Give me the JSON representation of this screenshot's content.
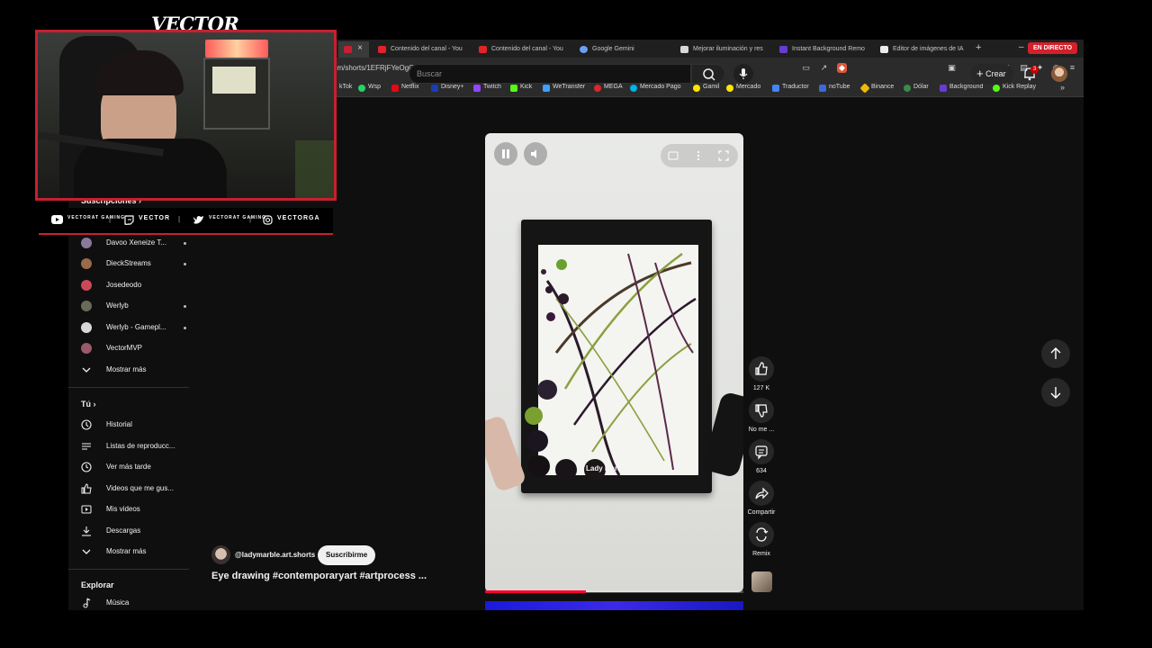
{
  "browser": {
    "tabs": [
      {
        "title": "",
        "fav_color": "#c7202f"
      },
      {
        "title": "Contenido del canal - You",
        "fav_color": "#e3222a"
      },
      {
        "title": "Contenido del canal - You",
        "fav_color": "#e3222a"
      },
      {
        "title": "Google Gemini",
        "fav_color": "#6aa0f4"
      },
      {
        "title": "Mejorar iluminación y res",
        "fav_color": "#d8d8d8"
      },
      {
        "title": "Instant Background Remo",
        "fav_color": "#6a3ad8"
      },
      {
        "title": "Editor de imágenes de IA",
        "fav_color": "#eaeaea"
      }
    ],
    "live_badge": "EN DIRECTO",
    "url": "om/shorts/1EFRjFYeOgQ",
    "bookmarks": [
      {
        "label": "kTok",
        "color": "#2b2b2b"
      },
      {
        "label": "Wsp",
        "color": "#25d366"
      },
      {
        "label": "Netflix",
        "color": "#e50914"
      },
      {
        "label": "Disney+",
        "color": "#1b3cb8"
      },
      {
        "label": "Twitch",
        "color": "#9146ff"
      },
      {
        "label": "Kick",
        "color": "#53fc18"
      },
      {
        "label": "WeTransfer",
        "color": "#409fff"
      },
      {
        "label": "MEGA",
        "color": "#d9272e"
      },
      {
        "label": "Mercado Pago",
        "color": "#00b1ea"
      },
      {
        "label": "Gamil",
        "color": "#ffe600"
      },
      {
        "label": "Mercado",
        "color": "#ffe600"
      },
      {
        "label": "Traductor",
        "color": "#4285f4"
      },
      {
        "label": "noTube",
        "color": "#3a6ad8"
      },
      {
        "label": "Binance",
        "color": "#f0b90b"
      },
      {
        "label": "Dólar",
        "color": "#3a8a4a"
      },
      {
        "label": "Background",
        "color": "#6a3ad8"
      },
      {
        "label": "Kick Replay",
        "color": "#53fc18"
      }
    ]
  },
  "youtube": {
    "search_placeholder": "Buscar",
    "create_label": "Crear",
    "notif_count": "3",
    "sidebar": {
      "subscriptions_heading": "Suscripciones",
      "channels": [
        {
          "name": "Davoo Xeneize T...",
          "live": true,
          "color": "#8a7a9a"
        },
        {
          "name": "DieckStreams",
          "live": true,
          "color": "#9a6a4a"
        },
        {
          "name": "Josedeodo",
          "live": false,
          "color": "#c84a5a"
        },
        {
          "name": "Werlyb",
          "live": true,
          "color": "#6a6a5a"
        },
        {
          "name": "Werlyb - Gamepl...",
          "live": true,
          "color": "#d8d8d8"
        },
        {
          "name": "VectorMVP",
          "live": false,
          "color": "#9a5a6a"
        }
      ],
      "show_more": "Mostrar más",
      "you_heading": "Tú",
      "you_items": [
        "Historial",
        "Listas de reproducc...",
        "Ver más tarde",
        "Videos que me gus...",
        "Mis videos",
        "Descargas",
        "Mostrar más"
      ],
      "explore_heading": "Explorar",
      "explore_items": [
        "Música"
      ]
    },
    "short": {
      "watermark": "Lady Marble Art",
      "progress": 0.39,
      "likes": "127 K",
      "dislike_label": "No me ...",
      "comments": "634",
      "share_label": "Compartir",
      "remix_label": "Remix",
      "channel": "@ladymarble.art.shorts",
      "subscribe_label": "Suscribirme",
      "title": "Eye drawing #contemporaryart  #artprocess ..."
    }
  },
  "stream_overlay": {
    "logo": "VECTOR",
    "socials": [
      {
        "icon": "youtube-icon",
        "label": "VECTORAT GAMING"
      },
      {
        "icon": "twitch-icon",
        "label": "VECTOR"
      },
      {
        "icon": "twitter-icon",
        "label": "VECTORAT GAMING"
      },
      {
        "icon": "instagram-icon",
        "label": "VECTORGA"
      }
    ],
    "frame_color": "#c7202f"
  }
}
